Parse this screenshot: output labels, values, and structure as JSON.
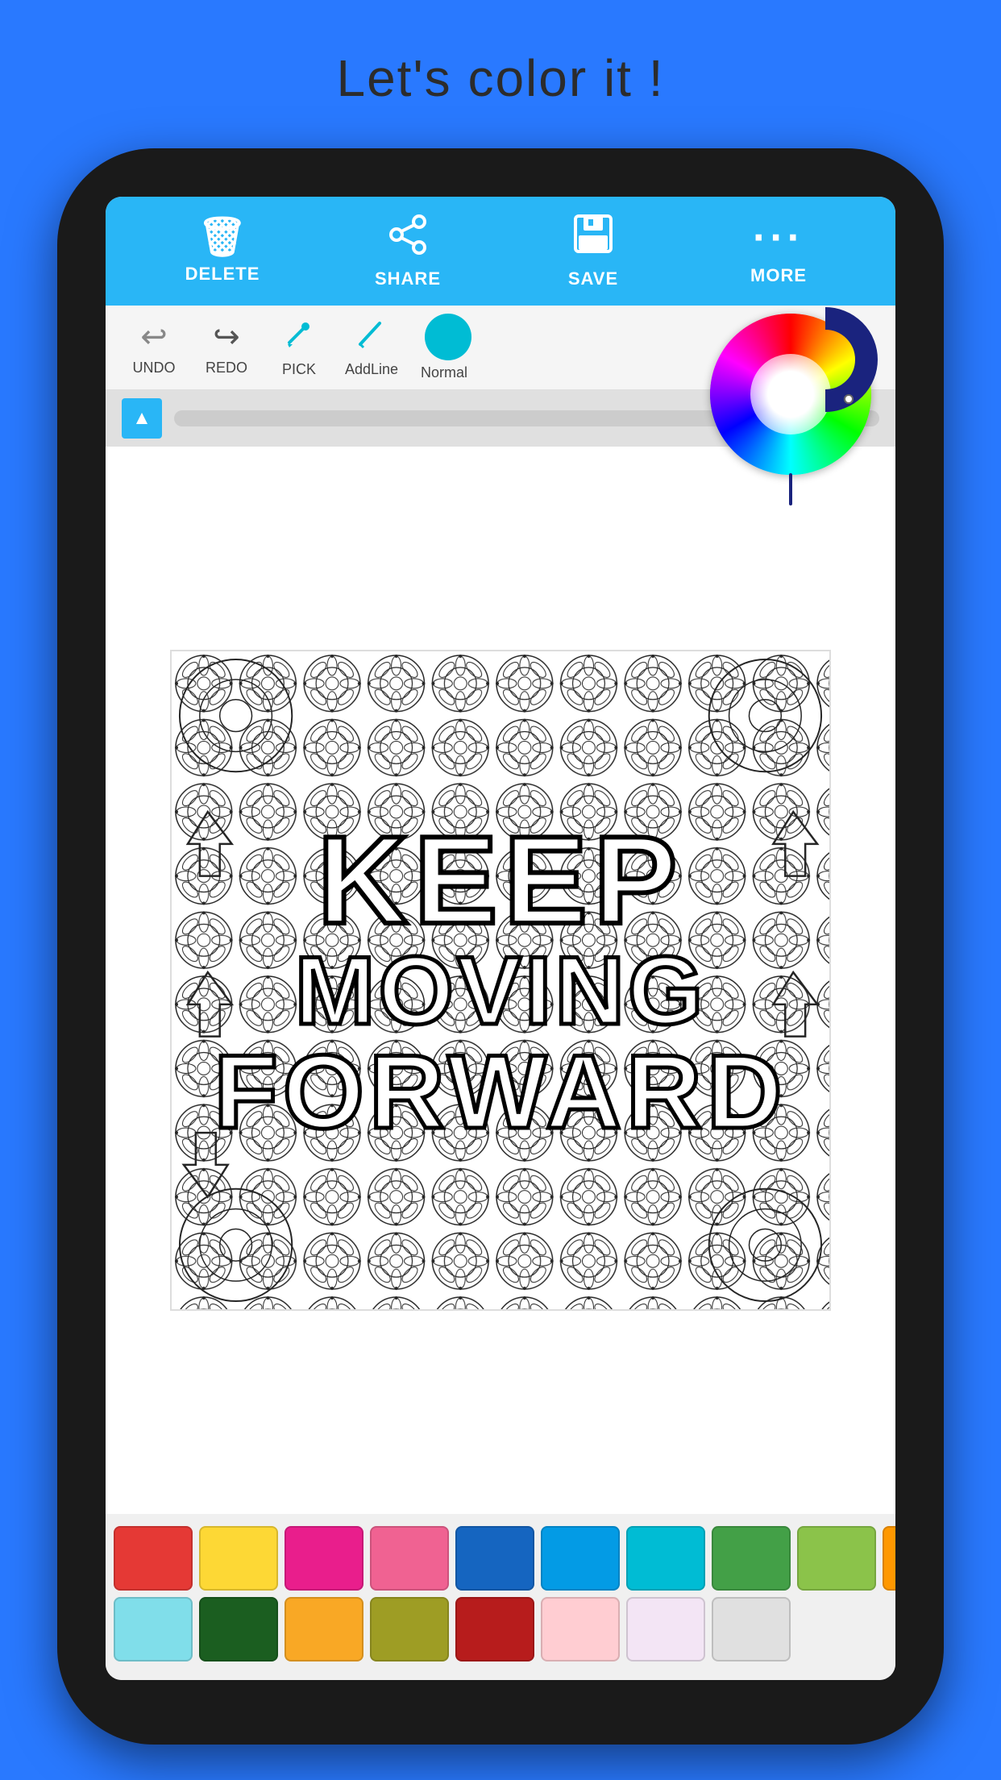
{
  "app": {
    "title": "Let's color it !"
  },
  "toolbar": {
    "buttons": [
      {
        "id": "delete",
        "label": "DELETE",
        "icon": "🗑"
      },
      {
        "id": "share",
        "label": "SHARE",
        "icon": "⬡"
      },
      {
        "id": "save",
        "label": "SAVE",
        "icon": "💾"
      },
      {
        "id": "more",
        "label": "MORE",
        "icon": "···"
      }
    ]
  },
  "secondary_toolbar": {
    "tools": [
      {
        "id": "undo",
        "label": "UNDO",
        "icon": "↩"
      },
      {
        "id": "redo",
        "label": "REDO",
        "icon": "↪"
      },
      {
        "id": "pick",
        "label": "PICK",
        "icon": "✏"
      },
      {
        "id": "addline",
        "label": "AddLine",
        "icon": "✏"
      },
      {
        "id": "normal",
        "label": "Normal",
        "color": "#00BCD4"
      }
    ]
  },
  "canvas": {
    "text_lines": [
      "KEEP",
      "MOVING",
      "FORWARD"
    ]
  },
  "palette": {
    "row1": [
      "#E53935",
      "#FDD835",
      "#E91E8C",
      "#F06292",
      "#1565C0",
      "#039BE5",
      "#00BCD4",
      "#43A047",
      "#8BC34A",
      "#FF9800"
    ],
    "row2": [
      "#80DEEA",
      "#1B5E20",
      "#F9A825",
      "#9E9D24",
      "#B71C1C",
      "#FFCDD2",
      "#F3E5F5",
      "#E0E0E0"
    ]
  },
  "colors": {
    "toolbar_bg": "#29B6F6",
    "app_bg": "#2979FF",
    "phone_frame": "#1a1a1a"
  }
}
